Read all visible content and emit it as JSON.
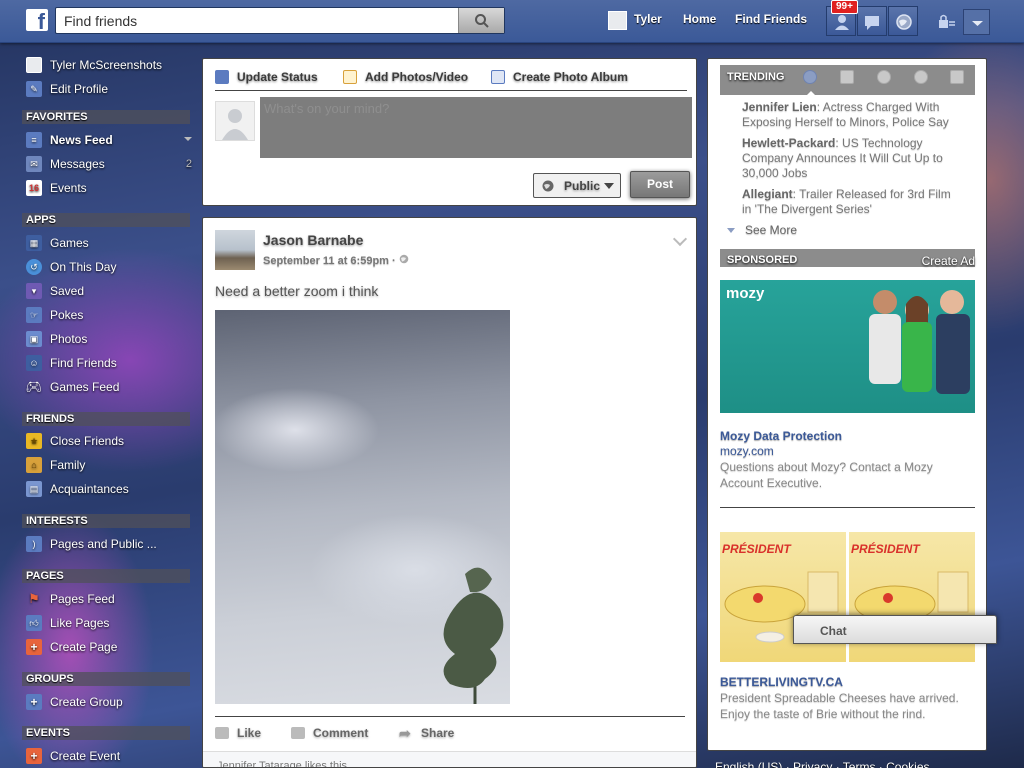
{
  "topbar": {
    "logo": "f",
    "search_placeholder": "Find friends",
    "user_name": "Tyler",
    "home": "Home",
    "find_friends": "Find Friends",
    "notification_badge": "99+"
  },
  "sidebar": {
    "profile_name": "Tyler McScreenshots",
    "edit_profile": "Edit Profile",
    "sections": {
      "favorites": "FAVORITES",
      "apps": "APPS",
      "friends": "FRIENDS",
      "interests": "INTERESTS",
      "pages": "PAGES",
      "groups": "GROUPS",
      "events": "EVENTS"
    },
    "favorites": [
      {
        "label": "News Feed",
        "icon": "news-feed-icon"
      },
      {
        "label": "Messages",
        "icon": "messages-icon",
        "count": "2"
      },
      {
        "label": "Events",
        "icon": "events-calendar-icon",
        "glyph": "16"
      }
    ],
    "apps": [
      {
        "label": "Games",
        "icon": "games-icon"
      },
      {
        "label": "On This Day",
        "icon": "on-this-day-icon"
      },
      {
        "label": "Saved",
        "icon": "saved-icon"
      },
      {
        "label": "Pokes",
        "icon": "pokes-icon"
      },
      {
        "label": "Photos",
        "icon": "photos-icon"
      },
      {
        "label": "Find Friends",
        "icon": "find-friends-icon"
      },
      {
        "label": "Games Feed",
        "icon": "gamepad-icon"
      }
    ],
    "friends": [
      {
        "label": "Close Friends",
        "icon": "star-icon"
      },
      {
        "label": "Family",
        "icon": "house-icon"
      },
      {
        "label": "Acquaintances",
        "icon": "acquaintances-icon"
      }
    ],
    "interests": [
      {
        "label": "Pages and Public ...",
        "icon": "rss-icon"
      }
    ],
    "pages": [
      {
        "label": "Pages Feed",
        "icon": "flag-icon"
      },
      {
        "label": "Like Pages",
        "icon": "thumbs-up-icon"
      },
      {
        "label": "Create Page",
        "icon": "plus-icon"
      }
    ],
    "groups": [
      {
        "label": "Create Group",
        "icon": "plus-icon"
      }
    ],
    "events": [
      {
        "label": "Create Event",
        "icon": "plus-icon"
      }
    ]
  },
  "composer": {
    "tabs": [
      "Update Status",
      "Add Photos/Video",
      "Create Photo Album"
    ],
    "placeholder": "What's on your mind?",
    "privacy": "Public",
    "post": "Post"
  },
  "story": {
    "author": "Jason Barnabe",
    "timestamp": "September 11 at 6:59pm",
    "separator": "·",
    "text": "Need a better zoom i think",
    "actions": [
      "Like",
      "Comment",
      "Share"
    ],
    "likes_text": "Jennifer Tatarage likes this."
  },
  "right": {
    "trending_title": "TRENDING",
    "trending": [
      {
        "topic": "Jennifer Lien",
        "text": ": Actress Charged With Exposing Herself to Minors, Police Say"
      },
      {
        "topic": "Hewlett-Packard",
        "text": ": US Technology Company Announces It Will Cut Up to 30,000 Jobs"
      },
      {
        "topic": "Allegiant",
        "text": ": Trailer Released for 3rd Film in 'The Divergent Series'"
      }
    ],
    "see_more": "See More",
    "sponsored": "SPONSORED",
    "create_ad": "Create Ad",
    "ad1": {
      "logo": "mozy",
      "title": "Mozy Data Protection",
      "domain": "mozy.com",
      "body": "Questions about Mozy? Contact a Mozy Account Executive."
    },
    "ad2": {
      "brand": "PRÉSIDENT",
      "domain": "BETTERLIVINGTV.CA",
      "body": "President Spreadable Cheeses have arrived. Enjoy the taste of Brie without the rind."
    }
  },
  "chat": {
    "label": "Chat"
  },
  "footer": {
    "text": "English (US) · Privacy · Terms · Cookies"
  },
  "colors": {
    "brand": "#3b5998",
    "badge": "#e02020"
  }
}
